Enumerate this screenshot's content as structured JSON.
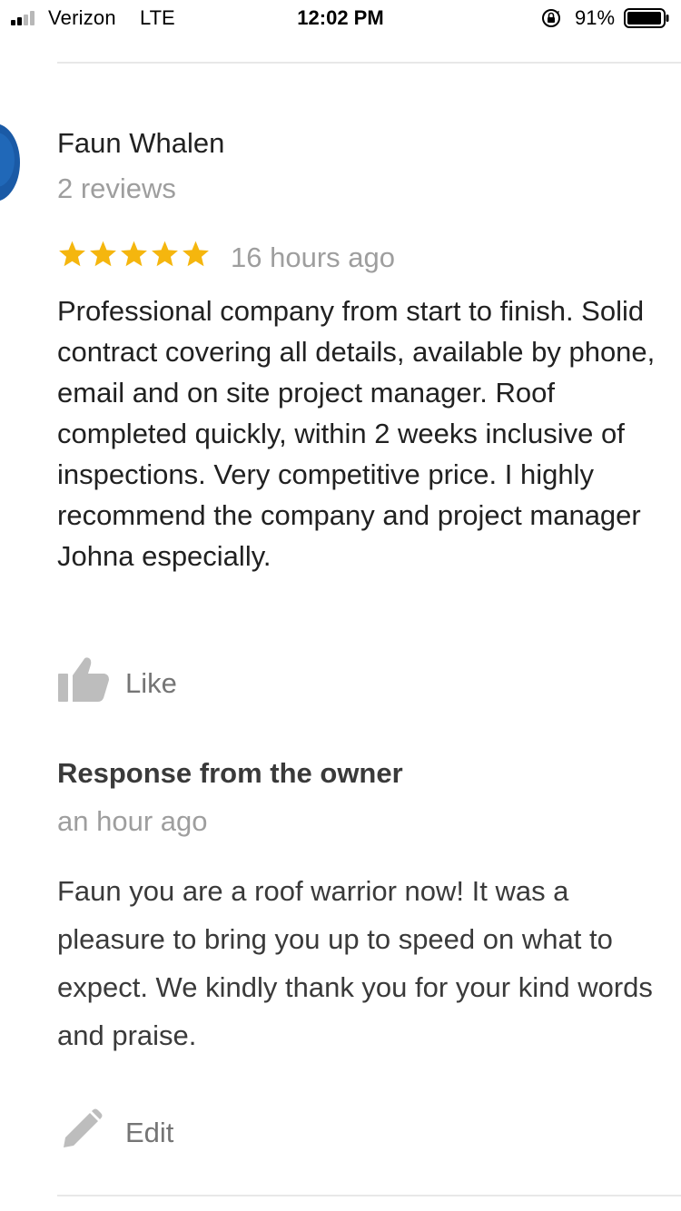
{
  "status_bar": {
    "carrier": "Verizon",
    "network": "LTE",
    "time": "12:02 PM",
    "battery_percent": "91%",
    "signal_bars_active": 2,
    "signal_bars_total": 4
  },
  "review": {
    "reviewer_name": "Faun Whalen",
    "review_count": "2 reviews",
    "rating": 5,
    "time_ago": "16 hours ago",
    "text": "Professional company from start to finish. Solid contract covering all details, available by phone, email and on site project manager. Roof completed quickly, within 2 weeks inclusive of inspections. Very competitive price. I highly recommend the company and project manager Johna especially.",
    "like_label": "Like"
  },
  "owner_response": {
    "title": "Response from the owner",
    "time_ago": "an hour ago",
    "text": "Faun you are a roof warrior now! It was a pleasure to bring you up to speed on what to expect. We kindly thank you for your kind words and praise.",
    "edit_label": "Edit"
  },
  "colors": {
    "star": "#f5b60e",
    "secondary_text": "#9e9e9e",
    "icon_gray": "#bdbdbd",
    "avatar": "#1a5aa6"
  },
  "icons": {
    "signal": "signal-strength-icon",
    "orientation_lock": "orientation-lock-icon",
    "battery": "battery-icon",
    "star": "star-icon",
    "like": "thumbs-up-icon",
    "edit": "pencil-icon"
  }
}
